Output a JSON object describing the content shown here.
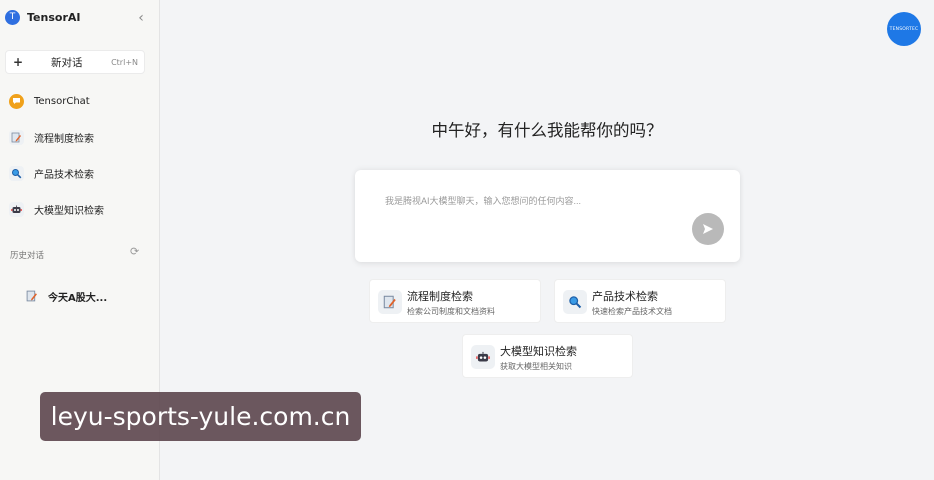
{
  "app": {
    "name": "TensorAI",
    "logo_letter": "T"
  },
  "sidebar": {
    "new_chat": {
      "label": "新对话",
      "shortcut": "Ctrl+N"
    },
    "nav": [
      {
        "label": "TensorChat",
        "icon": "chat-bubble-icon"
      },
      {
        "label": "流程制度检索",
        "icon": "document-pen-icon"
      },
      {
        "label": "产品技术检索",
        "icon": "magnifier-icon"
      },
      {
        "label": "大模型知识检索",
        "icon": "robot-icon"
      }
    ],
    "history_title": "历史对话",
    "history": [
      {
        "label": "今天A股大..."
      }
    ]
  },
  "header": {
    "avatar_text": "TENSORTEC"
  },
  "main": {
    "greeting": "中午好，有什么我能帮你的吗？",
    "input_placeholder": "我是腾视AI大模型聊天，输入您想问的任何内容...",
    "cards": [
      {
        "title": "流程制度检索",
        "desc": "检索公司制度和文档资料"
      },
      {
        "title": "产品技术检索",
        "desc": "快速检索产品技术文档"
      },
      {
        "title": "大模型知识检索",
        "desc": "获取大模型相关知识"
      }
    ]
  },
  "watermark": "leyu-sports-yule.com.cn",
  "colors": {
    "brand": "#2f6fe0",
    "avatar": "#1e78e6",
    "send_button": "#b9b9b9"
  }
}
